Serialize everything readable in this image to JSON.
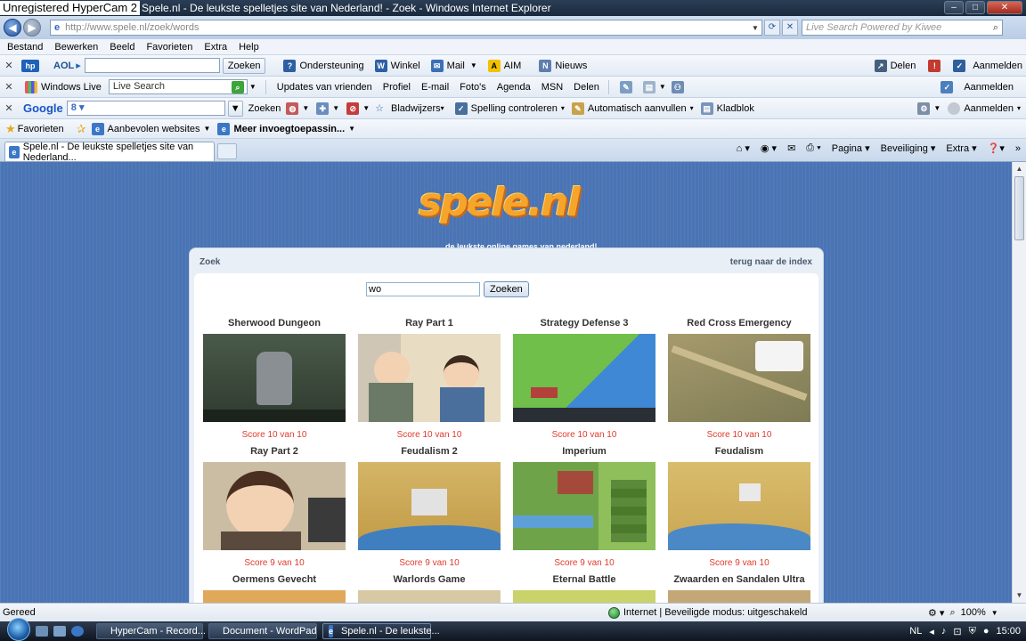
{
  "watermark": "Unregistered HyperCam 2",
  "window_title": "Spele.nl - De leukste spelletjes site van Nederland! - Zoek - Windows Internet Explorer",
  "address": {
    "url": "http://www.spele.nl/zoek/words",
    "live_search_placeholder": "Live Search Powered by Kiwee"
  },
  "menu": [
    "Bestand",
    "Bewerken",
    "Beeld",
    "Favorieten",
    "Extra",
    "Help"
  ],
  "toolbar_aol": {
    "brand": "AOL",
    "search_button": "Zoeken",
    "items": [
      "Ondersteuning",
      "Winkel",
      "Mail",
      "AIM",
      "Nieuws"
    ],
    "right_share": "Delen",
    "right_signin": "Aanmelden"
  },
  "toolbar_live": {
    "brand": "Windows Live",
    "search_placeholder": "Live Search",
    "items": [
      "Updates van vrienden",
      "Profiel",
      "E-mail",
      "Foto's",
      "Agenda",
      "MSN",
      "Delen"
    ],
    "right_signin": "Aanmelden"
  },
  "toolbar_google": {
    "brand": "Google",
    "search_button": "Zoeken",
    "items": [
      "Bladwijzers",
      "Spelling controleren",
      "Automatisch aanvullen",
      "Kladblok"
    ],
    "right_signin": "Aanmelden"
  },
  "favorites_bar": {
    "favorites": "Favorieten",
    "suggested": "Aanbevolen websites",
    "more": "Meer invoegtoepassin..."
  },
  "tab": {
    "title": "Spele.nl - De leukste spelletjes site van Nederland..."
  },
  "command_bar": [
    "Pagina",
    "Beveiliging",
    "Extra"
  ],
  "site": {
    "logo": "spele.nl",
    "tagline": "de leukste online games van nederland!",
    "panel_title": "Zoek",
    "back_link": "terug naar de index",
    "search_value": "wo",
    "search_button": "Zoeken",
    "games": [
      {
        "name": "Sherwood Dungeon",
        "score": "Score 10 van 10"
      },
      {
        "name": "Ray Part 1",
        "score": "Score 10 van 10"
      },
      {
        "name": "Strategy Defense 3",
        "score": "Score 10 van 10"
      },
      {
        "name": "Red Cross Emergency",
        "score": "Score 10 van 10"
      },
      {
        "name": "Ray Part 2",
        "score": "Score 9 van 10"
      },
      {
        "name": "Feudalism 2",
        "score": "Score 9 van 10"
      },
      {
        "name": "Imperium",
        "score": "Score 9 van 10"
      },
      {
        "name": "Feudalism",
        "score": "Score 9 van 10"
      },
      {
        "name": "Oermens Gevecht",
        "score": ""
      },
      {
        "name": "Warlords Game",
        "score": ""
      },
      {
        "name": "Eternal Battle",
        "score": ""
      },
      {
        "name": "Zwaarden en Sandalen Ultra",
        "score": ""
      }
    ]
  },
  "status": {
    "left": "Gereed",
    "zone": "Internet | Beveiligde modus: uitgeschakeld",
    "zoom": "100%"
  },
  "taskbar": {
    "tasks": [
      "HyperCam - Record...",
      "Document - WordPad",
      "Spele.nl - De leukste..."
    ],
    "language": "NL",
    "clock": "15:00"
  },
  "colors": {
    "page_bg": "#4c78ba",
    "score_red": "#e03a2b",
    "logo_orange": "#f4a52a"
  }
}
